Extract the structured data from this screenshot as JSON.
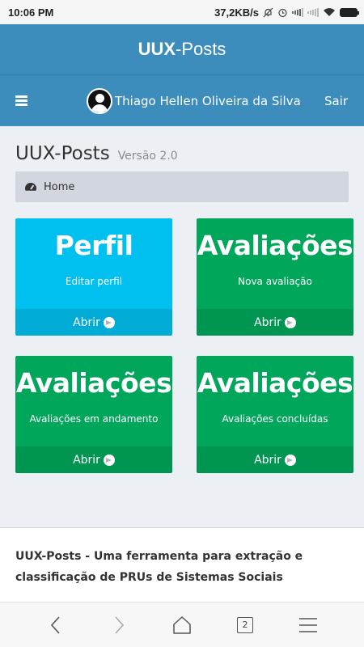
{
  "status_bar": {
    "time": "10:06 PM",
    "network_speed": "37,2KB/s"
  },
  "app": {
    "brand_bold": "UUX",
    "brand_rest": "-Posts"
  },
  "navbar": {
    "user_name": "Thiago Hellen Oliveira da Silva",
    "signout_label": "Sair"
  },
  "content_header": {
    "title": "UUX-Posts",
    "version": "Versão 2.0"
  },
  "breadcrumb": {
    "home_label": "Home"
  },
  "boxes": [
    {
      "title": "Perfil",
      "subtitle": "Editar perfil",
      "link_label": "Abrir",
      "color": "#00c0ef"
    },
    {
      "title": "Avaliações",
      "subtitle": "Nova avaliação",
      "link_label": "Abrir",
      "color": "#00a65a"
    },
    {
      "title": "Avaliações",
      "subtitle": "Avaliações em andamento",
      "link_label": "Abrir",
      "color": "#00a65a"
    },
    {
      "title": "Avaliações",
      "subtitle": "Avaliações concluídas",
      "link_label": "Abrir",
      "color": "#00a65a"
    }
  ],
  "footer": {
    "text": "UUX-Posts - Uma ferramenta para extração e classificação de PRUs de Sistemas Sociais"
  },
  "browser": {
    "tab_count": "2"
  },
  "colors": {
    "header": "#3c8dbc",
    "aqua": "#00c0ef",
    "green": "#00a65a",
    "background": "#ecf0f5",
    "breadcrumb": "#d2d6de"
  }
}
